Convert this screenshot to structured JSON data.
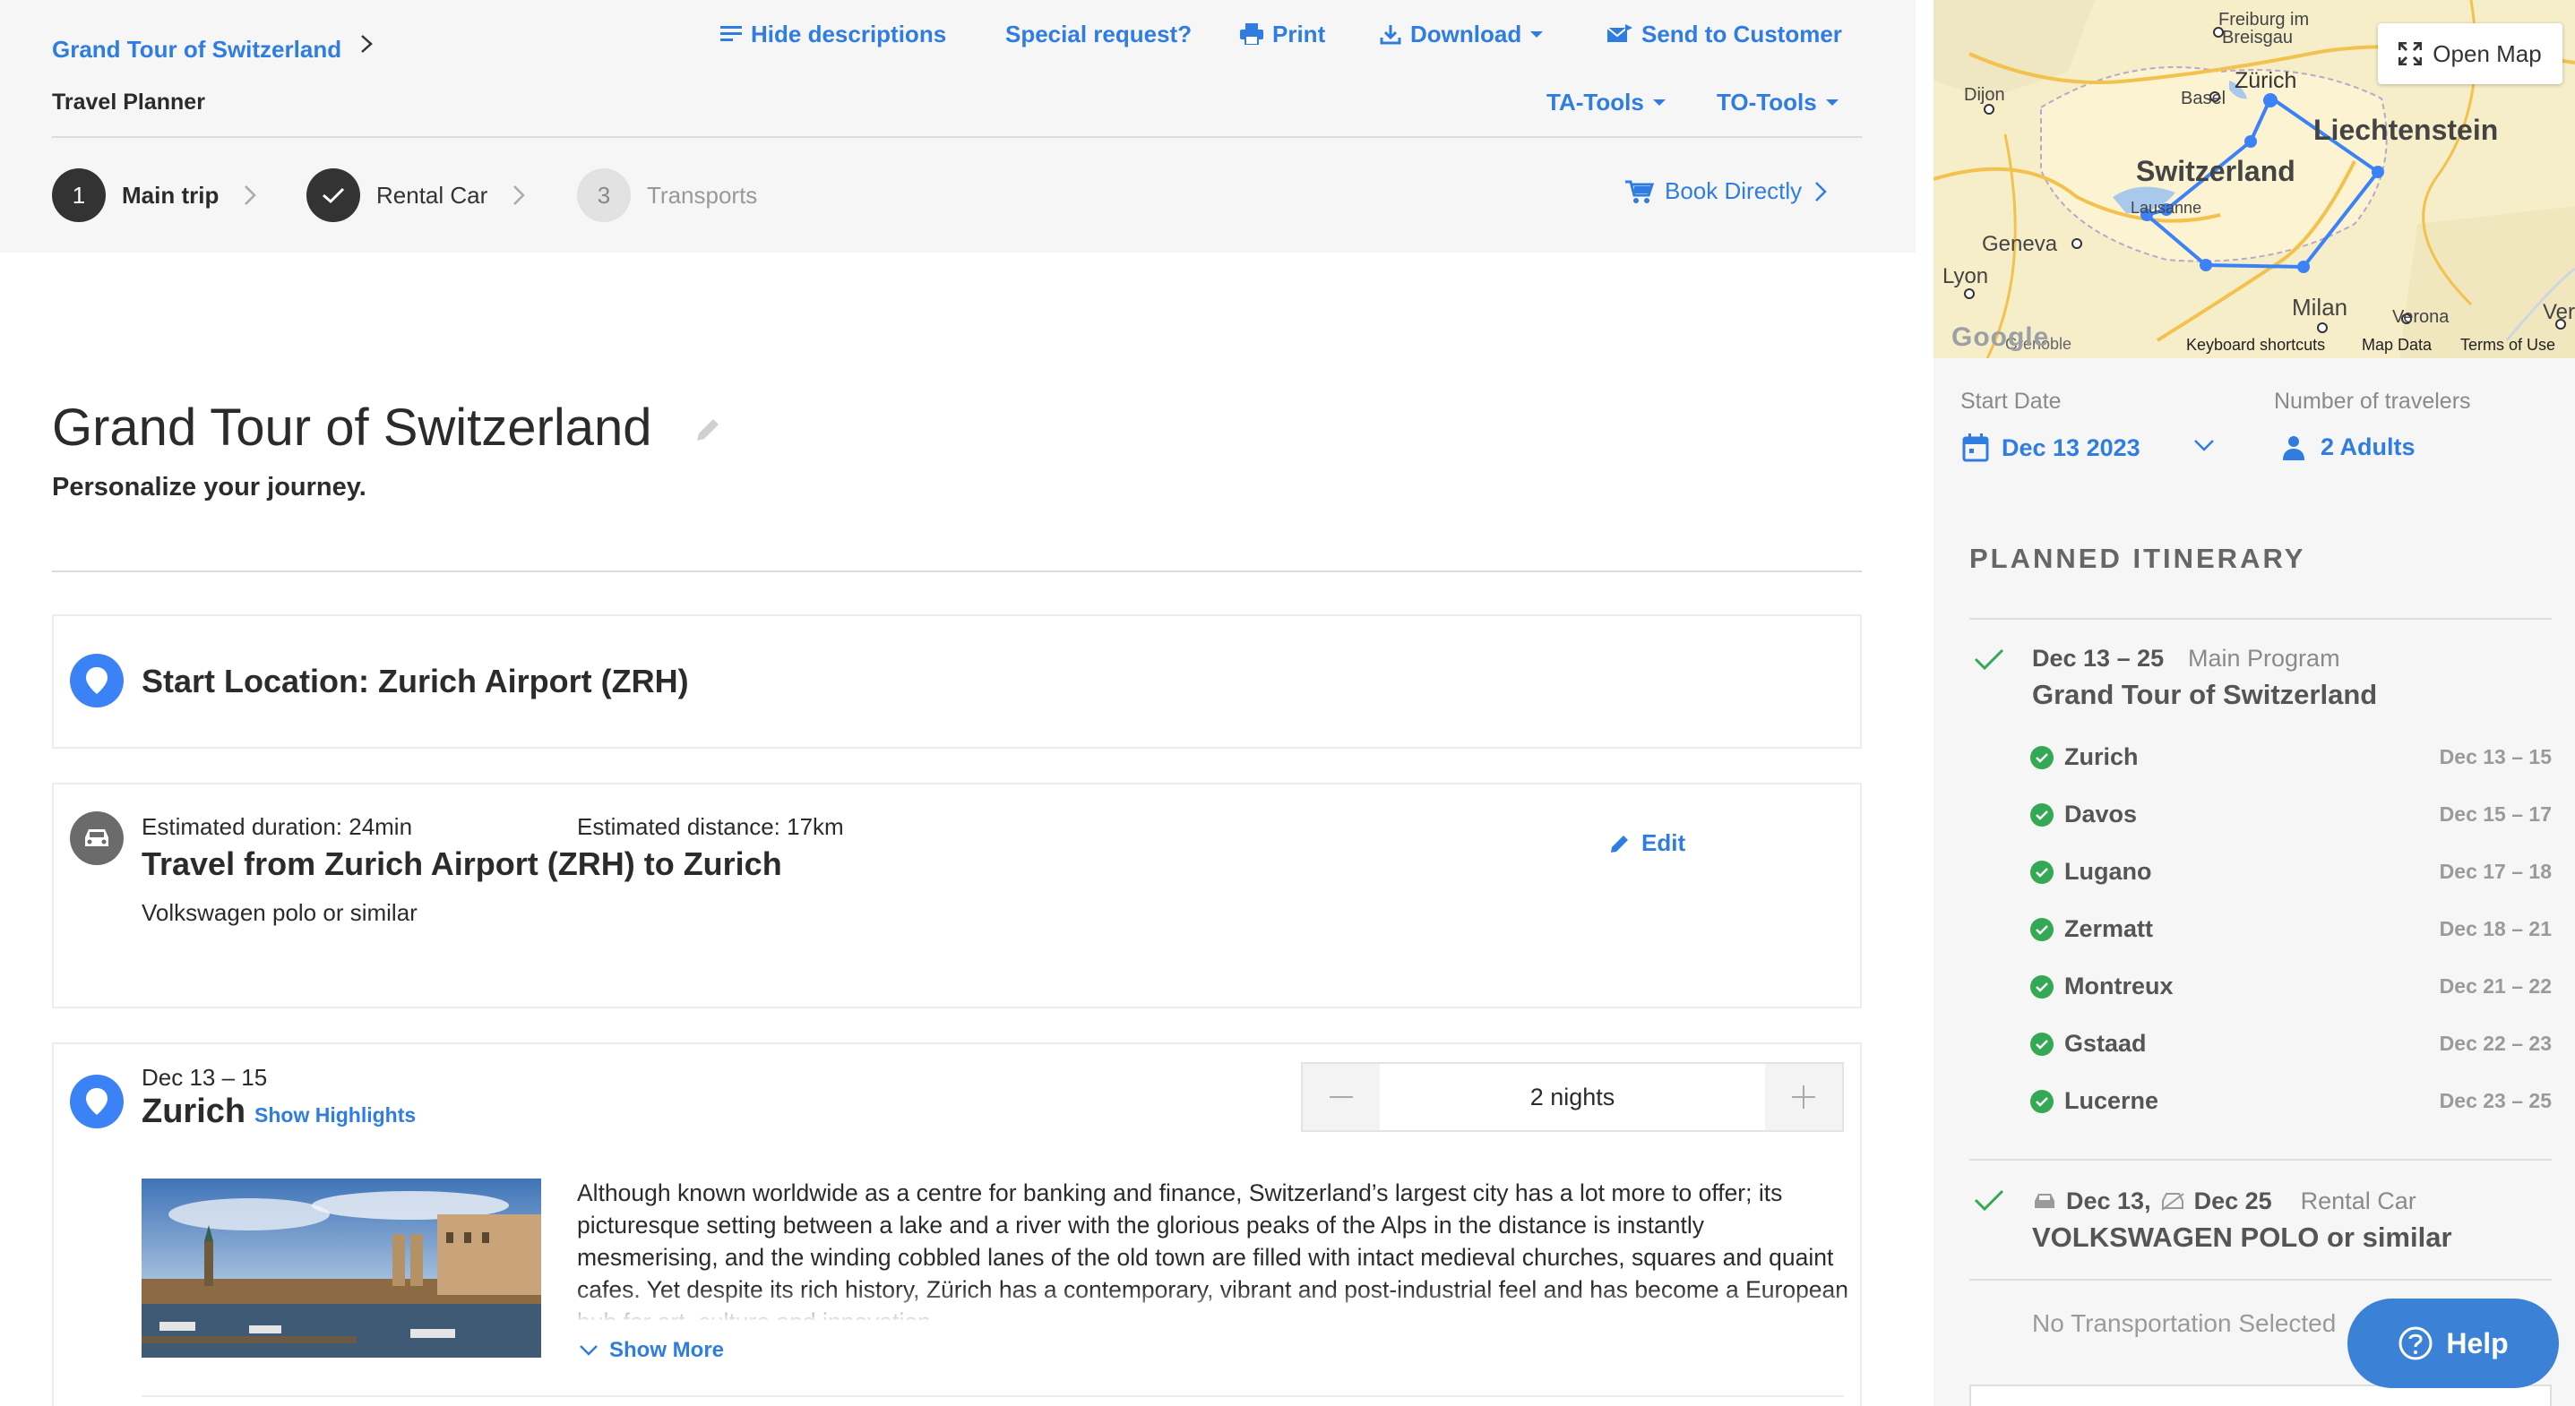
{
  "header": {
    "breadcrumb_title": "Grand Tour of Switzerland",
    "subtitle": "Travel Planner",
    "toolbar": {
      "hide_descriptions": "Hide descriptions",
      "special_request": "Special request?",
      "print": "Print",
      "download": "Download",
      "send_to_customer": "Send to Customer",
      "ta_tools": "TA-Tools",
      "to_tools": "TO-Tools"
    }
  },
  "steps": [
    {
      "number": "1",
      "label": "Main trip"
    },
    {
      "number": "",
      "label": "Rental Car"
    },
    {
      "number": "3",
      "label": "Transports"
    }
  ],
  "book_directly": "Book Directly",
  "trip": {
    "title": "Grand Tour of Switzerland",
    "subtitle": "Personalize your journey."
  },
  "start_location": "Start Location: Zurich Airport (ZRH)",
  "travel": {
    "duration": "Estimated duration: 24min",
    "distance": "Estimated distance: 17km",
    "title": "Travel from Zurich Airport (ZRH) to Zurich",
    "car": "Volkswagen polo or similar",
    "edit": "Edit"
  },
  "zurich": {
    "dates": "Dec 13 – 15",
    "city": "Zurich",
    "show_highlights": "Show Highlights",
    "nights": "2 nights",
    "description": "Although known worldwide as a centre for banking and finance, Switzerland’s largest city has a lot more to offer; its picturesque setting between a lake and a river with the glorious peaks of the Alps in the distance is instantly mesmerising, and the winding cobbled lanes of the old town are filled with intact medieval churches, squares and quaint cafes. Yet despite its rich history, Zürich has a contemporary, vibrant and post-industrial feel and has become a European hub for art, culture and innovation.",
    "show_more": "Show More"
  },
  "map": {
    "open_map": "Open Map",
    "labels": {
      "freiburg": "Freiburg im",
      "breisgau": "Breisgau",
      "zurich": "Zürich",
      "basel": "Basel",
      "dijon": "Dijon",
      "liechtenstein": "Liechtenstein",
      "switzerland": "Switzerland",
      "lausanne": "Lausanne",
      "geneva": "Geneva",
      "lyon": "Lyon",
      "milan": "Milan",
      "verona": "Verona",
      "ver": "Ver",
      "grenoble": "Grenoble"
    },
    "google": "Google",
    "keyboard_shortcuts": "Keyboard shortcuts",
    "map_data": "Map Data",
    "terms": "Terms of Use"
  },
  "sidebar": {
    "start_date_label": "Start Date",
    "start_date": "Dec 13 2023",
    "travelers_label": "Number of travelers",
    "travelers": "2 Adults",
    "itinerary_title": "PLANNED ITINERARY",
    "main_program": {
      "dates": "Dec 13 – 25",
      "type": "Main Program",
      "name": "Grand Tour of Switzerland"
    },
    "cities": [
      {
        "name": "Zurich",
        "dates": "Dec 13 – 15"
      },
      {
        "name": "Davos",
        "dates": "Dec 15 – 17"
      },
      {
        "name": "Lugano",
        "dates": "Dec 17 – 18"
      },
      {
        "name": "Zermatt",
        "dates": "Dec 18 – 21"
      },
      {
        "name": "Montreux",
        "dates": "Dec 21 – 22"
      },
      {
        "name": "Gstaad",
        "dates": "Dec 22 – 23"
      },
      {
        "name": "Lucerne",
        "dates": "Dec 23 – 25"
      }
    ],
    "rental_car": {
      "pickup": "Dec 13,",
      "dropoff": "Dec 25",
      "type": "Rental Car",
      "name": "VOLKSWAGEN POLO or similar"
    },
    "no_transportation": "No Transportation Selected",
    "help": "Help"
  },
  "colors": {
    "accent": "#2f7de1",
    "pin": "#3b82f6",
    "success": "#34a853",
    "help": "#3b82d6"
  }
}
